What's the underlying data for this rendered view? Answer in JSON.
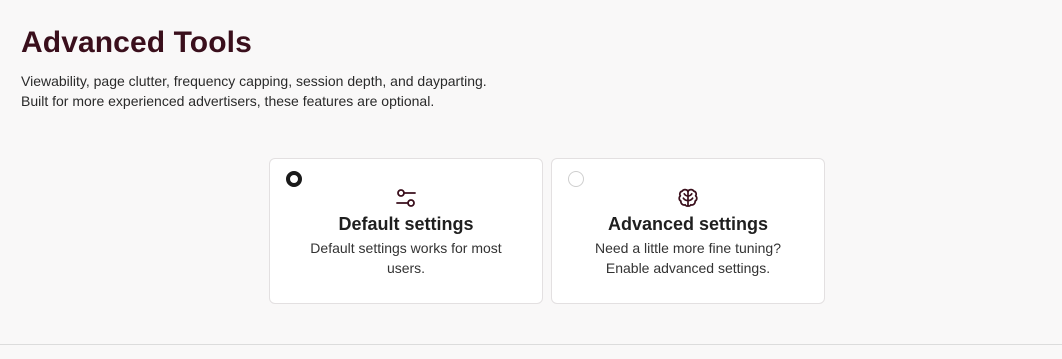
{
  "header": {
    "title": "Advanced Tools",
    "description_line1": "Viewability, page clutter, frequency capping, session depth, and dayparting.",
    "description_line2": "Built for more experienced advertisers, these features are optional."
  },
  "options": [
    {
      "title": "Default settings",
      "description": "Default settings works for most users.",
      "icon": "sliders-icon",
      "selected": true
    },
    {
      "title": "Advanced settings",
      "description": "Need a little more fine tuning? Enable advanced settings.",
      "icon": "brain-icon",
      "selected": false
    }
  ],
  "colors": {
    "title": "#3a0f1c",
    "icon": "#3a0f1c",
    "radio_checked": "#1a1a1a",
    "card_border": "#e3e0e1",
    "background": "#f9f8f8"
  }
}
